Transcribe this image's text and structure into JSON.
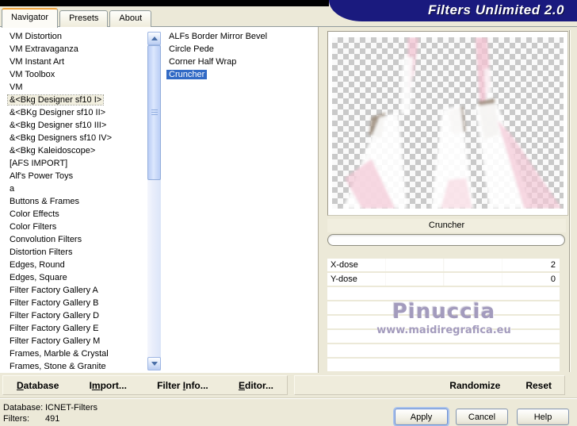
{
  "banner": {
    "title": "Filters Unlimited 2.0"
  },
  "tabs": {
    "navigator": "Navigator",
    "presets": "Presets",
    "about": "About"
  },
  "category_list": {
    "items": [
      "VM Distortion",
      "VM Extravaganza",
      "VM Instant Art",
      "VM Toolbox",
      "VM",
      {
        "label": "&<Bkg Designer sf10 I>",
        "state": "focused"
      },
      "&<BKg Designer sf10 II>",
      "&<Bkg Designer sf10 III>",
      "&<Bkg Designers sf10 IV>",
      "&<Bkg Kaleidoscope>",
      "[AFS IMPORT]",
      "Alf's Power Toys",
      "a",
      "Buttons & Frames",
      "Color Effects",
      "Color Filters",
      "Convolution Filters",
      "Distortion Filters",
      "Edges, Round",
      "Edges, Square",
      "Filter Factory Gallery A",
      "Filter Factory Gallery B",
      "Filter Factory Gallery D",
      "Filter Factory Gallery E",
      "Filter Factory Gallery M",
      "Frames, Marble & Crystal",
      "Frames, Stone & Granite"
    ]
  },
  "filter_list": {
    "items": [
      "ALFs Border Mirror Bevel",
      "Circle Pede",
      "Corner Half Wrap",
      {
        "label": "Cruncher",
        "state": "selected"
      }
    ]
  },
  "preview": {
    "filter_name": "Cruncher"
  },
  "controls": {
    "sliders": [
      {
        "label": "X-dose",
        "value": "2"
      },
      {
        "label": "Y-dose",
        "value": "0"
      }
    ]
  },
  "watermark": {
    "line1": "Pinuccia",
    "line2": "www.maidiregrafica.eu"
  },
  "toolbar": {
    "database": {
      "pre": "",
      "accel": "D",
      "post": "atabase"
    },
    "import": {
      "pre": "I",
      "accel": "m",
      "post": "port..."
    },
    "filter_info": {
      "pre": "Filter ",
      "accel": "I",
      "post": "nfo..."
    },
    "editor": {
      "pre": "",
      "accel": "E",
      "post": "ditor..."
    },
    "randomize": "Randomize",
    "reset": "Reset"
  },
  "status": {
    "database_label": "Database:",
    "database_value": "ICNET-Filters",
    "filters_label": "Filters:",
    "filters_value": "491"
  },
  "actions": {
    "apply": "Apply",
    "cancel": "Cancel",
    "help": "Help"
  },
  "colors": {
    "banner_bg": "#1A1A7E",
    "selection": "#316AC5",
    "dialog_bg": "#ECE9D8",
    "tab_accent": "#EFA33C",
    "watermark": "#A39BBD"
  }
}
